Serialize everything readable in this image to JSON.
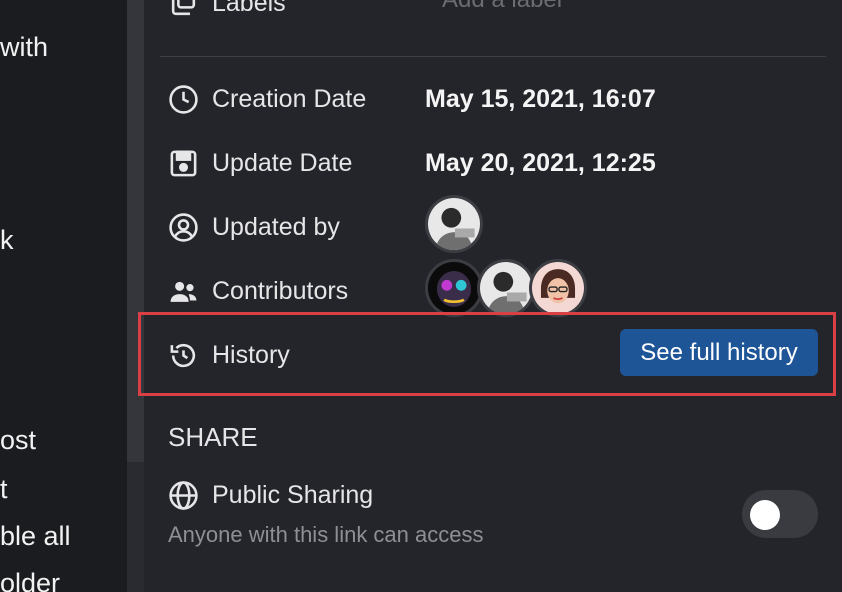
{
  "left_fragments": [
    "with",
    "k",
    "ost",
    "t",
    "ble all",
    "older"
  ],
  "details": {
    "labels": {
      "label": "Labels",
      "placeholder": "Add a label"
    },
    "creation_date": {
      "label": "Creation Date",
      "value": "May 15, 2021, 16:07"
    },
    "update_date": {
      "label": "Update Date",
      "value": "May 20, 2021, 12:25"
    },
    "updated_by": {
      "label": "Updated by"
    },
    "contributors": {
      "label": "Contributors"
    },
    "history": {
      "label": "History",
      "button": "See full history"
    }
  },
  "share": {
    "title": "SHARE",
    "public_sharing": {
      "label": "Public Sharing",
      "description": "Anyone with this link can access",
      "enabled": false
    }
  },
  "colors": {
    "accent_button": "#1d5596",
    "highlight_border": "#d94045",
    "panel_bg": "#24252a"
  },
  "icons": {
    "labels": "label-icon",
    "creation_date": "clock-icon",
    "update_date": "save-icon",
    "updated_by": "user-circle-icon",
    "contributors": "people-icon",
    "history": "history-icon",
    "public_sharing": "globe-icon"
  }
}
